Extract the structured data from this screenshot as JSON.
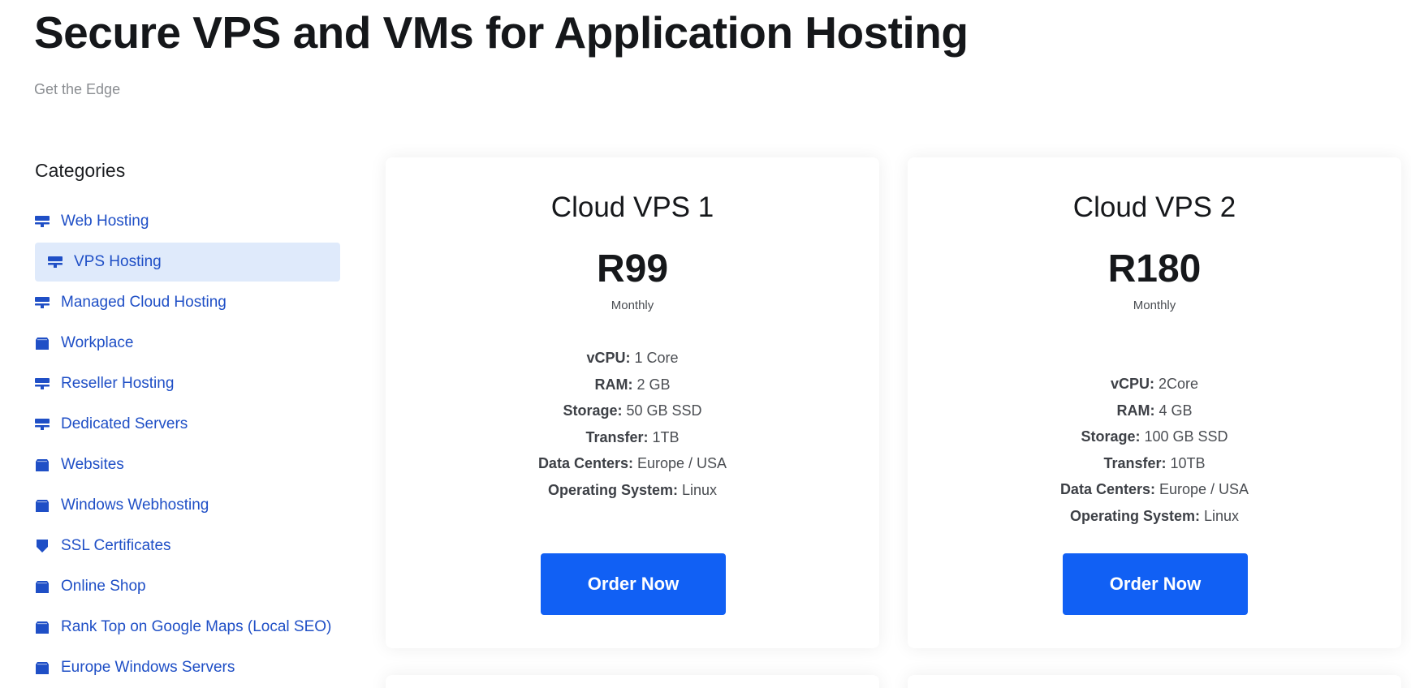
{
  "header": {
    "title": "Secure VPS and VMs for Application Hosting",
    "subtitle": "Get the Edge"
  },
  "sidebar": {
    "heading": "Categories",
    "accent_color": "#1f4fc6",
    "active_bg": "#dfeafb",
    "items": [
      {
        "label": "Web Hosting",
        "icon": "server-icon",
        "active": false
      },
      {
        "label": "VPS Hosting",
        "icon": "server-icon",
        "active": true
      },
      {
        "label": "Managed Cloud Hosting",
        "icon": "server-icon",
        "active": false
      },
      {
        "label": "Workplace",
        "icon": "box-icon",
        "active": false
      },
      {
        "label": "Reseller Hosting",
        "icon": "server-icon",
        "active": false
      },
      {
        "label": "Dedicated Servers",
        "icon": "server-icon",
        "active": false
      },
      {
        "label": "Websites",
        "icon": "box-icon",
        "active": false
      },
      {
        "label": "Windows Webhosting",
        "icon": "box-icon",
        "active": false
      },
      {
        "label": "SSL Certificates",
        "icon": "shield-icon",
        "active": false
      },
      {
        "label": "Online Shop",
        "icon": "box-icon",
        "active": false
      },
      {
        "label": "Rank Top on Google Maps (Local SEO)",
        "icon": "box-icon",
        "active": false
      },
      {
        "label": "Europe Windows Servers",
        "icon": "box-icon",
        "active": false
      }
    ]
  },
  "plans": [
    {
      "name": "Cloud VPS 1",
      "price": "R99",
      "period": "Monthly",
      "specs": [
        {
          "label": "vCPU:",
          "value": " 1 Core"
        },
        {
          "label": "RAM:",
          "value": " 2 GB"
        },
        {
          "label": "Storage:",
          "value": " 50 GB SSD"
        },
        {
          "label": "Transfer:",
          "value": " 1TB"
        },
        {
          "label": "Data Centers:",
          "value": " Europe / USA"
        },
        {
          "label": "Operating System:",
          "value": " Linux"
        }
      ],
      "button_label": "Order Now"
    },
    {
      "name": "Cloud VPS 2",
      "price": "R180",
      "period": "Monthly",
      "specs": [
        {
          "label": "vCPU:",
          "value": " 2Core"
        },
        {
          "label": "RAM:",
          "value": " 4 GB"
        },
        {
          "label": "Storage:",
          "value": " 100 GB SSD"
        },
        {
          "label": "Transfer:",
          "value": " 10TB"
        },
        {
          "label": "Data Centers:",
          "value": " Europe / USA"
        },
        {
          "label": "Operating System:",
          "value": " Linux"
        }
      ],
      "button_label": "Order Now"
    }
  ],
  "colors": {
    "button": "#1160f4",
    "title_text": "#15171a"
  }
}
